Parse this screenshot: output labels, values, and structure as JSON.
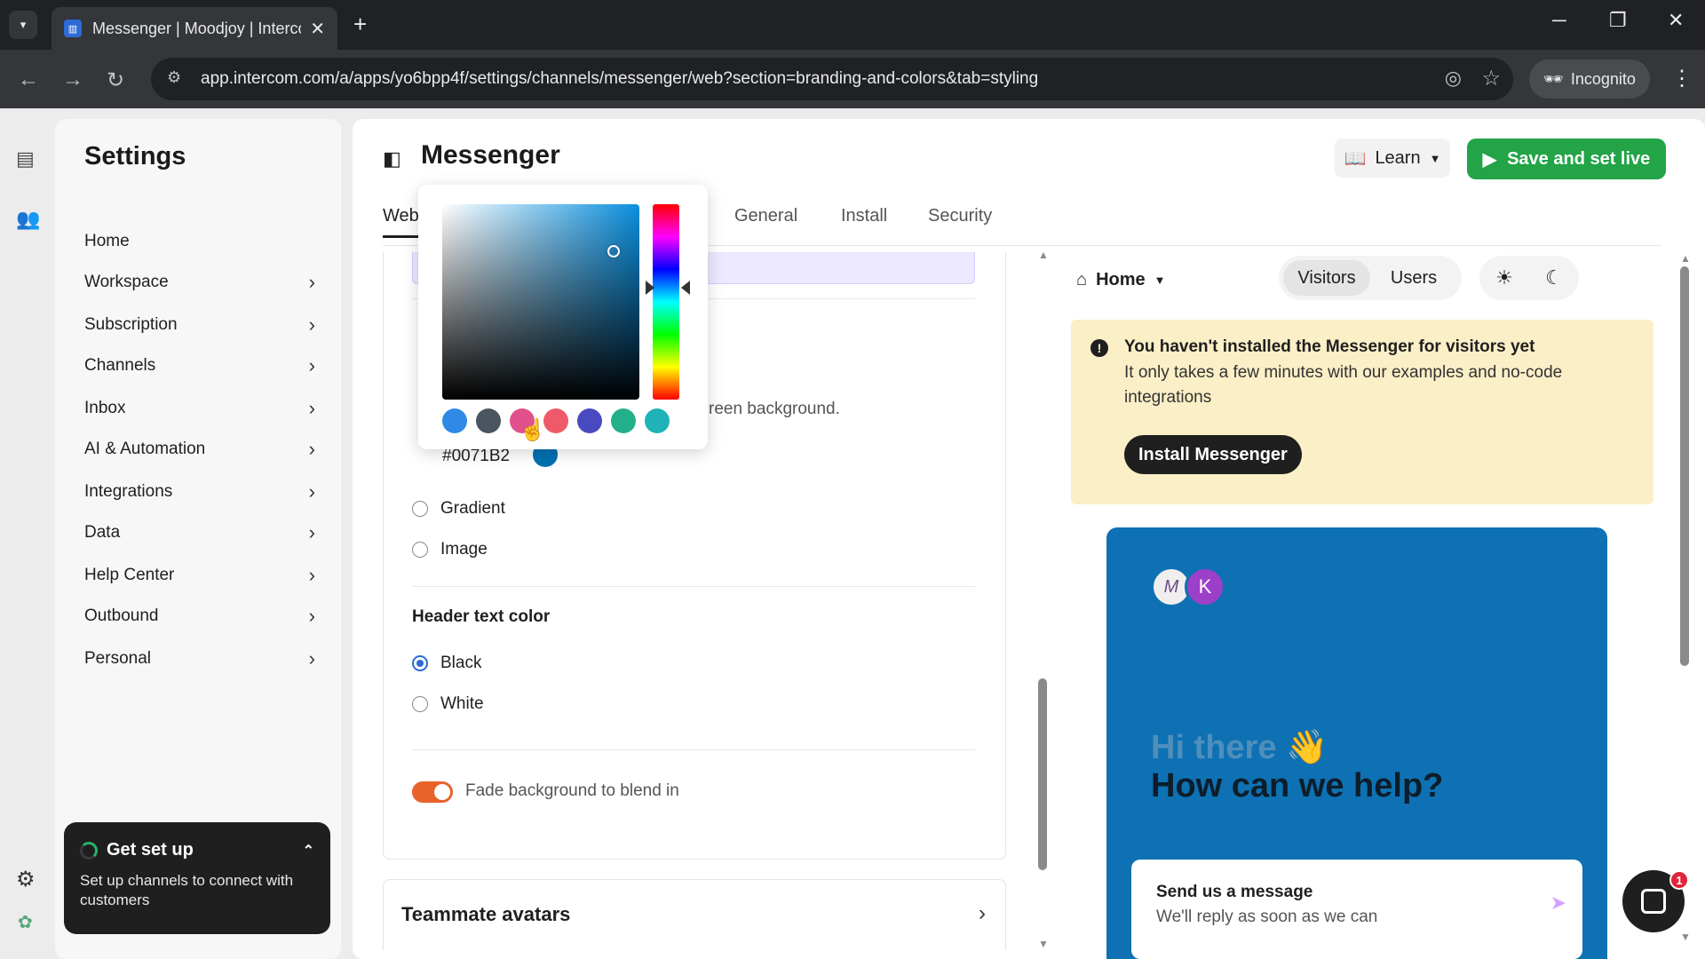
{
  "browser": {
    "tab_title": "Messenger | Moodjoy | Intercom",
    "url": "app.intercom.com/a/apps/yo6bpp4f/settings/channels/messenger/web?section=branding-and-colors&tab=styling",
    "incognito_label": "Incognito",
    "new_tab_symbol": "+",
    "close_symbol": "✕"
  },
  "sidebar": {
    "title": "Settings",
    "items": [
      {
        "label": "Home",
        "has_chevron": false
      },
      {
        "label": "Workspace",
        "has_chevron": true
      },
      {
        "label": "Subscription",
        "has_chevron": true
      },
      {
        "label": "Channels",
        "has_chevron": true
      },
      {
        "label": "Inbox",
        "has_chevron": true
      },
      {
        "label": "AI & Automation",
        "has_chevron": true
      },
      {
        "label": "Integrations",
        "has_chevron": true
      },
      {
        "label": "Data",
        "has_chevron": true
      },
      {
        "label": "Help Center",
        "has_chevron": true
      },
      {
        "label": "Outbound",
        "has_chevron": true
      },
      {
        "label": "Personal",
        "has_chevron": true
      }
    ],
    "chevron": "›",
    "get_set_up": {
      "title": "Get set up",
      "text": "Set up channels to connect with customers"
    }
  },
  "header": {
    "title": "Messenger",
    "learn_label": "Learn",
    "save_label": "Save and set live"
  },
  "tabs": [
    {
      "label": "Web",
      "active": true
    },
    {
      "label": "General",
      "active": false
    },
    {
      "label": "Install",
      "active": false
    },
    {
      "label": "Security",
      "active": false
    }
  ],
  "config": {
    "partial_background_text": "reen background.",
    "hex_value": "#0071B2",
    "background_options": [
      {
        "label": "Gradient",
        "selected": false
      },
      {
        "label": "Image",
        "selected": false
      }
    ],
    "header_text_color_label": "Header text color",
    "header_text_options": [
      {
        "label": "Black",
        "selected": true
      },
      {
        "label": "White",
        "selected": false
      }
    ],
    "fade_label": "Fade background to blend in",
    "fade_on": true,
    "teammate_avatars_label": "Teammate avatars"
  },
  "color_picker": {
    "base_color": "#0a8fde",
    "presets": [
      "#2e8ae6",
      "#4a5560",
      "#e0508a",
      "#ef5a6a",
      "#4a4ac0",
      "#22b08a",
      "#1fb3b8"
    ]
  },
  "preview": {
    "home_label": "Home",
    "audience_tabs": [
      {
        "label": "Visitors",
        "active": true
      },
      {
        "label": "Users",
        "active": false
      }
    ],
    "banner": {
      "title": "You haven't installed the Messenger for visitors yet",
      "subtitle": "It only takes a few minutes with our examples and no-code integrations",
      "button": "Install Messenger"
    },
    "messenger": {
      "brand_color": "#0e71b3",
      "avatar_letter": "K",
      "greeting": "Hi there 👋",
      "help_text": "How can we help?",
      "send_title": "Send us a message",
      "send_subtitle": "We'll reply as soon as we can"
    },
    "launcher_badge": "1"
  }
}
